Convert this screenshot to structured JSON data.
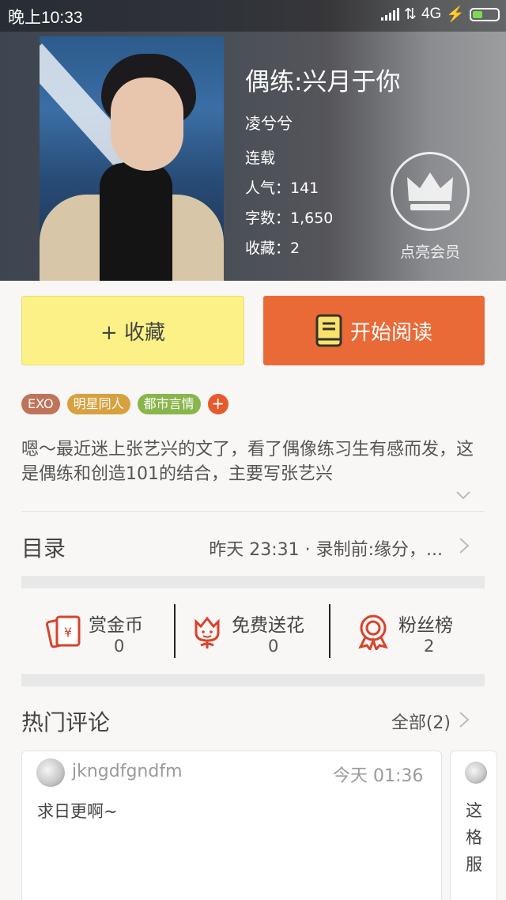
{
  "status_bar": {
    "time": "晚上10:33",
    "network": "4G"
  },
  "book": {
    "title": "偶练:兴月于你",
    "author": "凌兮兮",
    "status": "连载",
    "popularity": "人气：141",
    "word_count": "字数：1,650",
    "favorites": "收藏：2"
  },
  "vip": {
    "label": "点亮会员"
  },
  "actions": {
    "collect_label": "+ 收藏",
    "read_label": "开始阅读"
  },
  "tags": [
    {
      "label": "EXO",
      "color": "#c0735b"
    },
    {
      "label": "明星同人",
      "color": "#d6a13e"
    },
    {
      "label": "都市言情",
      "color": "#8ab54c"
    }
  ],
  "tag_add": "+",
  "description": "嗯～最近迷上张艺兴的文了，看了偶像练习生有感而发，这是偶练和创造101的结合，主要写张艺兴",
  "toc": {
    "label": "目录",
    "latest": "昨天 23:31 · 录制前:缘分，..."
  },
  "stats": [
    {
      "label": "赏金币",
      "value": "0"
    },
    {
      "label": "免费送花",
      "value": "0"
    },
    {
      "label": "粉丝榜",
      "value": "2"
    }
  ],
  "comments_section": {
    "title": "热门评论",
    "all_label": "全部(2)"
  },
  "comments": [
    {
      "user": "jkngdfgndfm",
      "time": "今天 01:36",
      "text": "求日更啊~"
    },
    {
      "text": "这格服"
    }
  ],
  "colors": {
    "accent": "#ea6a37",
    "collect_bg": "#fbf187",
    "icon_red": "#d9432b"
  }
}
